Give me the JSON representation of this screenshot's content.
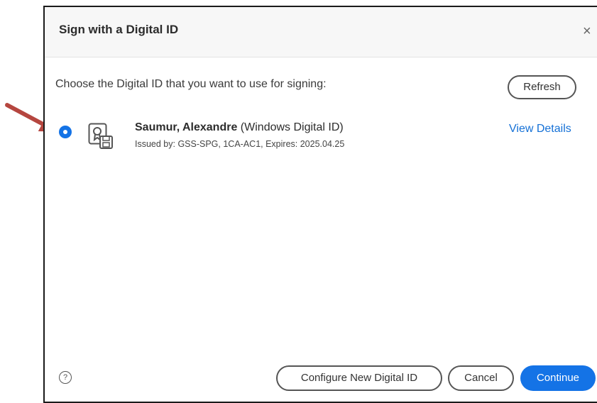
{
  "dialog": {
    "title": "Sign with a Digital ID",
    "close_glyph": "×"
  },
  "prompt": "Choose the Digital ID that you want to use for signing:",
  "refresh_label": "Refresh",
  "digital_id": {
    "name": "Saumur, Alexandre",
    "type": " (Windows Digital ID)",
    "issued": "Issued by: GSS-SPG, 1CA-AC1, Expires: 2025.04.25",
    "selected": true,
    "icon": "certificate-icon"
  },
  "view_details_label": "View Details",
  "footer": {
    "help_glyph": "?",
    "help_icon": "help-icon",
    "configure_label": "Configure New Digital ID",
    "cancel_label": "Cancel",
    "continue_label": "Continue"
  },
  "colors": {
    "accent": "#1473e6",
    "link": "#1470d6",
    "annotation_arrow": "#b5463f"
  }
}
